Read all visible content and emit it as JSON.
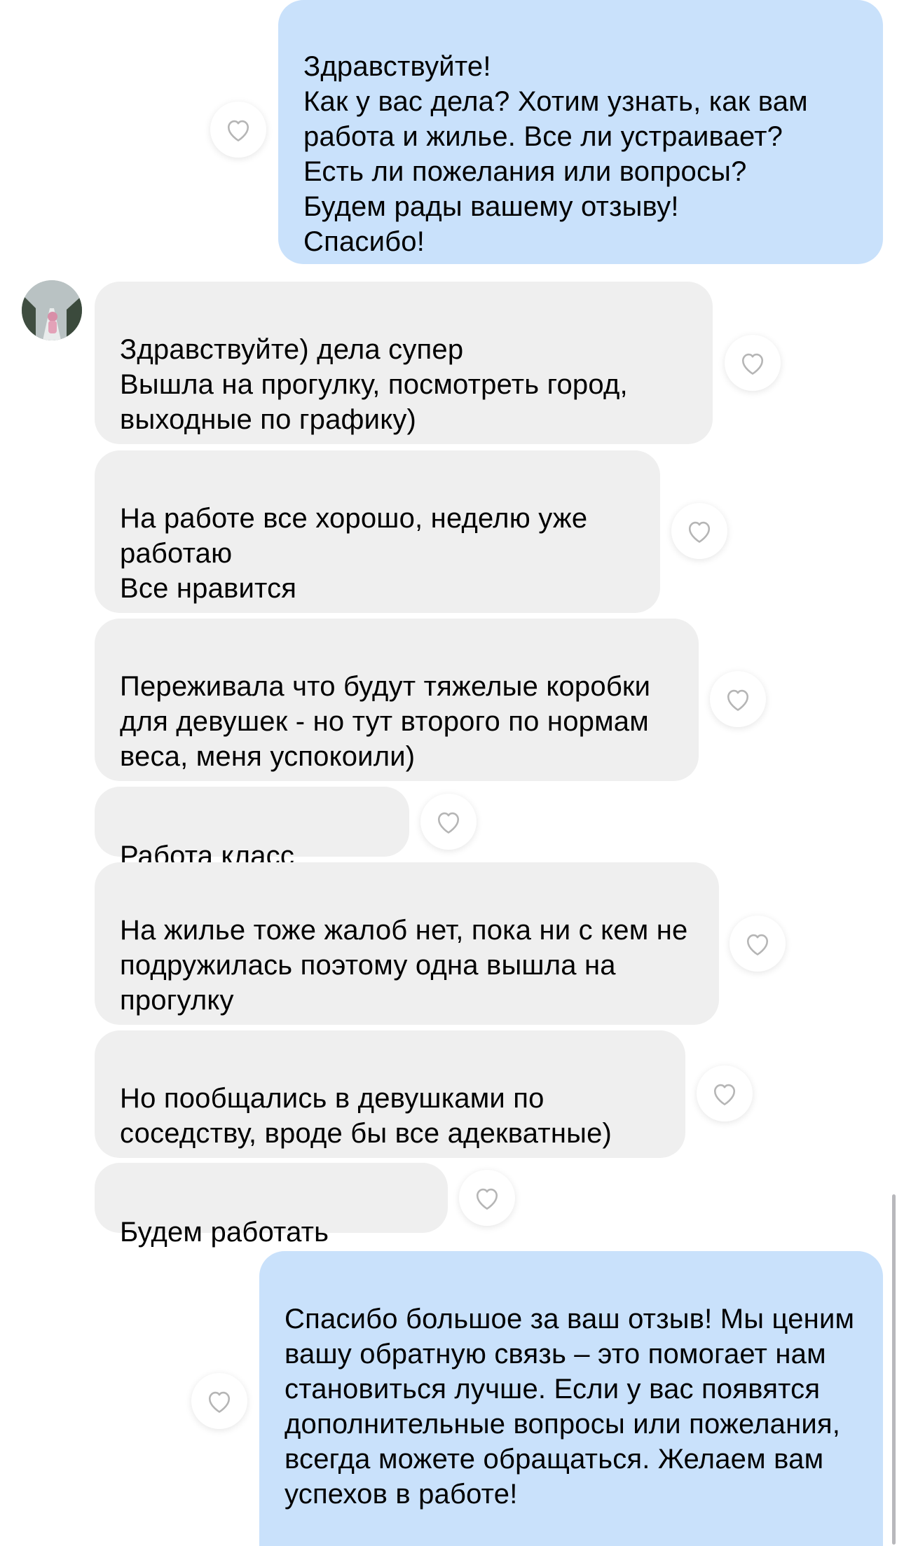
{
  "messages": [
    {
      "id": 1,
      "direction": "out",
      "text": "Здравствуйте!\nКак у вас дела? Хотим узнать, как вам работа и жилье. Все ли устраивает?\nЕсть ли пожелания или вопросы?\nБудем рады вашему отзыву!\nСпасибо!"
    },
    {
      "id": 2,
      "direction": "in",
      "text": "Здравствуйте) дела супер\nВышла на прогулку, посмотреть город, выходные по графику)"
    },
    {
      "id": 3,
      "direction": "in",
      "text": "На работе все хорошо, неделю уже работаю\nВсе нравится"
    },
    {
      "id": 4,
      "direction": "in",
      "text": "Переживала что будут тяжелые коробки для девушек - но тут второго по нормам веса, меня успокоили)"
    },
    {
      "id": 5,
      "direction": "in",
      "text": "Работа класс"
    },
    {
      "id": 6,
      "direction": "in",
      "text": "На жилье тоже жалоб нет, пока ни с кем не подружилась поэтому одна вышла на прогулку"
    },
    {
      "id": 7,
      "direction": "in",
      "text": "Но пообщались в девушками по соседству, вроде бы все адекватные)"
    },
    {
      "id": 8,
      "direction": "in",
      "text": "Будем работать"
    },
    {
      "id": 9,
      "direction": "out",
      "text": "Спасибо большое за ваш отзыв! Мы ценим вашу обратную связь – это помогает нам становиться лучше. Если у вас появятся дополнительные вопросы или пожелания, всегда можете обращаться. Желаем вам успехов в работе!"
    }
  ],
  "icons": {
    "like": "heart-outline-icon",
    "avatar": "user-avatar-photo"
  },
  "colors": {
    "outgoing_bubble": "#c9e1fb",
    "incoming_bubble": "#efefef",
    "heart_stroke": "#b5b5b5"
  }
}
